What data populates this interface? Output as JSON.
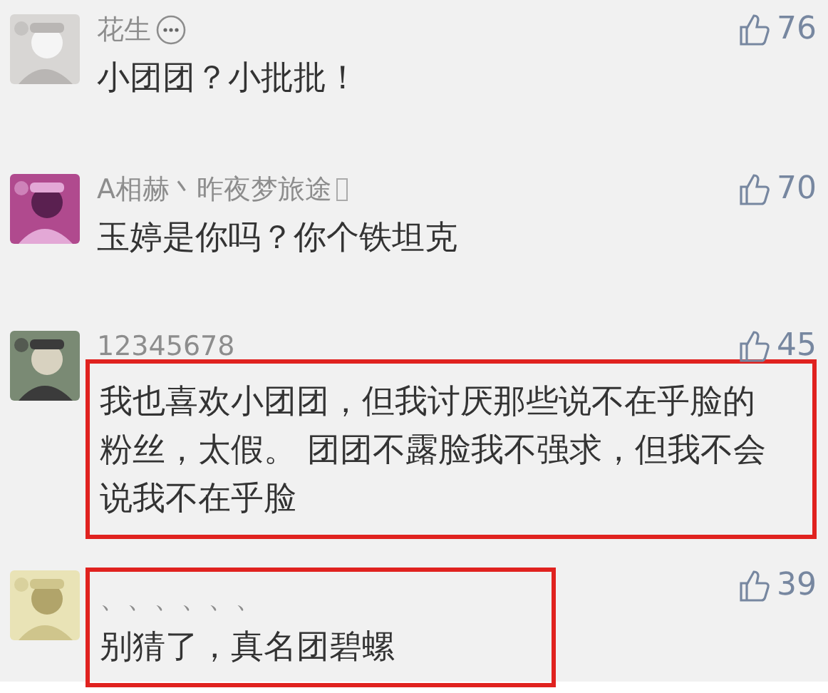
{
  "comments": [
    {
      "user": "花生",
      "more_badge": true,
      "text": "小团团？小批批！",
      "likes": "76",
      "highlighted": false
    },
    {
      "user": "A相赫丶昨夜梦旅途",
      "box_badge": true,
      "text": "玉婷是你吗？你个铁坦克",
      "likes": "70",
      "highlighted": false
    },
    {
      "user": "12345678",
      "text": "我也喜欢小团团，但我讨厌那些说不在乎脸的粉丝，太假。 团团不露脸我不强求，但我不会说我不在乎脸",
      "likes": "45",
      "highlighted": true,
      "name_highlighted": false
    },
    {
      "user": "、、、、、、",
      "text": "别猜了，真名团碧螺",
      "likes": "39",
      "highlighted": true,
      "name_highlighted": true
    }
  ]
}
